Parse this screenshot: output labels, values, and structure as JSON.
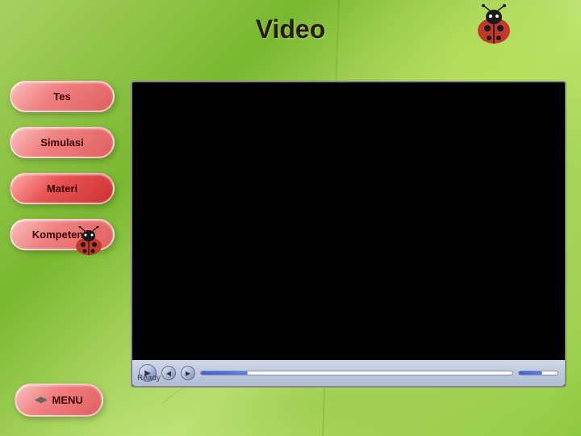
{
  "page": {
    "title": "Video",
    "background_color": "#7ab830"
  },
  "sidebar": {
    "buttons": [
      {
        "id": "tes",
        "label": "Tes",
        "active": false
      },
      {
        "id": "simulasi",
        "label": "Simulasi",
        "active": false
      },
      {
        "id": "materi",
        "label": "Materi",
        "active": true
      },
      {
        "id": "kompetensi",
        "label": "Kompetensi",
        "active": false
      }
    ],
    "menu_label": "MENU"
  },
  "player": {
    "status": "Ready",
    "progress_percent": 15,
    "volume_percent": 60
  },
  "controls": {
    "play": "▶",
    "prev": "◀◀",
    "next": "▶▶",
    "stop": "■"
  }
}
